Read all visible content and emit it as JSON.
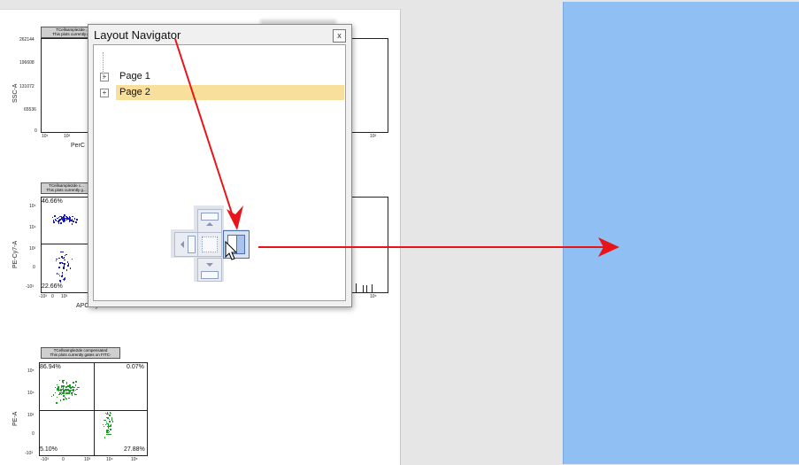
{
  "dialog": {
    "title": "Layout Navigator",
    "close_glyph": "x",
    "tree": [
      {
        "label": "Page 1",
        "expander": "+",
        "selected": false
      },
      {
        "label": "Page 2",
        "expander": "+",
        "selected": true
      }
    ]
  },
  "plots": {
    "p1": {
      "title1": "TCellsample2de ...",
      "title2": "This plots currently g...",
      "ylabel": "SSC-A",
      "xlabel": "PerC",
      "yticks": [
        "262144",
        "196608",
        "131072",
        "65536",
        "0"
      ],
      "xticks": [
        "10¹",
        "10²"
      ]
    },
    "p1b": {
      "xticks": [
        "10²"
      ]
    },
    "p2": {
      "title1": "TCellsample2de c...",
      "title2": "This plots currently g...",
      "ylabel": "PE-Cy7-A",
      "xlabel": "APC-Cy7-A",
      "q_tl": "46.66%",
      "q_bl": "22.66%",
      "yticks": [
        "10⁵",
        "10⁴",
        "10³",
        "0",
        "-10³"
      ],
      "xticks": [
        "-10³",
        "0",
        "10³"
      ]
    },
    "p2b": {
      "xlabel": "APC-A",
      "xticks": [
        "10⁵"
      ]
    },
    "p3": {
      "title1": "TCellsample2de compensated",
      "title2": "This plots currently gates on FITC-",
      "ylabel": "PE-A",
      "q_tl": "86.94%",
      "q_tr": "0.07%",
      "q_bl": "5.10%",
      "q_br": "27.88%",
      "yticks": [
        "10⁵",
        "10⁴",
        "10³",
        "0",
        "-10³"
      ],
      "xticks": [
        "-10³",
        "0",
        "10³",
        "10⁴",
        "10⁵"
      ]
    }
  },
  "colors": {
    "annotation_arrow": "#e8141a",
    "dock_preview": "#8fbff3",
    "selection": "#f8df9b",
    "scatter_blue": "#1a1ab4",
    "scatter_green": "#1f9a2a"
  }
}
